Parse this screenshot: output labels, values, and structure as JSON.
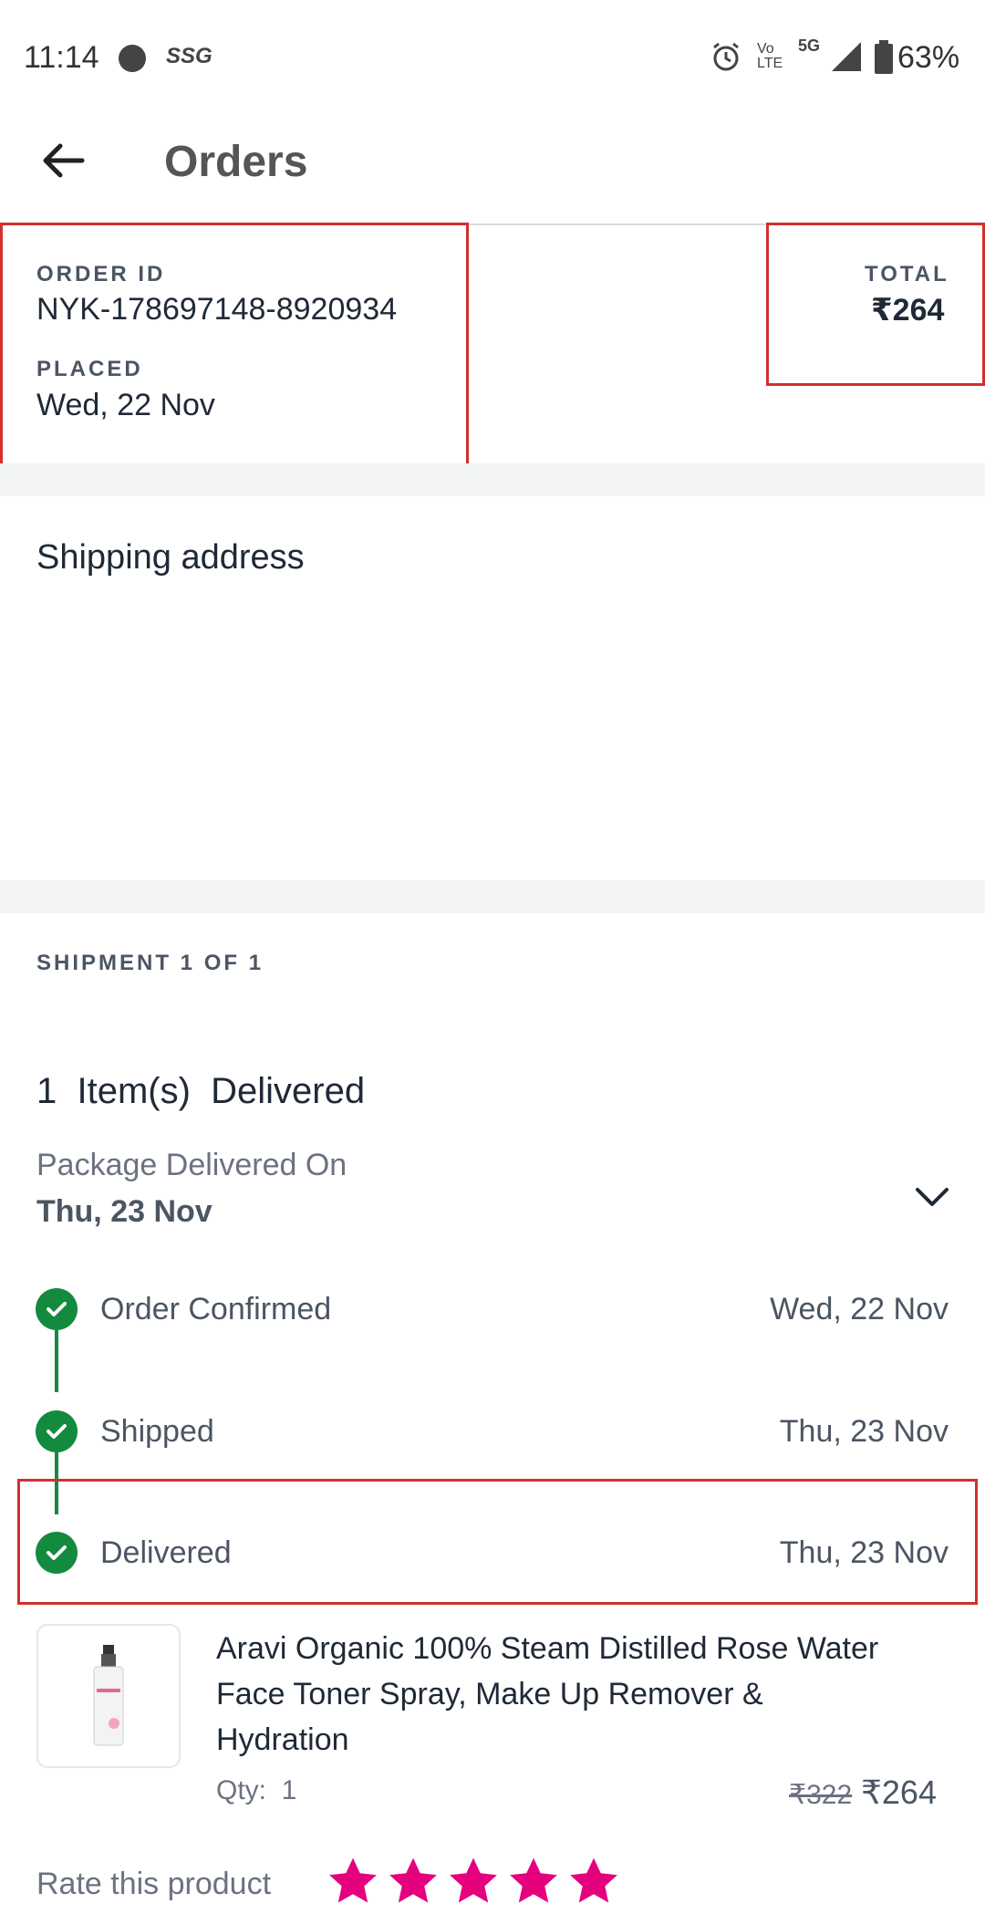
{
  "status_bar": {
    "time": "11:14",
    "carrier_tag": "SSG",
    "volte": "Vo LTE",
    "network": "5G",
    "battery": "63%"
  },
  "header": {
    "title": "Orders"
  },
  "order": {
    "order_id_label": "ORDER ID",
    "order_id": "NYK-178697148-8920934",
    "placed_label": "PLACED",
    "placed_date": "Wed, 22 Nov",
    "total_label": "TOTAL",
    "total_value": "₹264"
  },
  "shipping": {
    "title": "Shipping address"
  },
  "shipment": {
    "label": "SHIPMENT 1 OF 1",
    "status_title": "1  Item(s)  Delivered",
    "delivered_on_label": "Package Delivered On",
    "delivered_on_date": "Thu, 23 Nov",
    "timeline": [
      {
        "label": "Order Confirmed",
        "date": "Wed, 22 Nov"
      },
      {
        "label": "Shipped",
        "date": "Thu, 23 Nov"
      },
      {
        "label": "Delivered",
        "date": "Thu, 23 Nov"
      }
    ]
  },
  "product": {
    "name_line1": "Aravi Organic 100% Steam Distilled Rose Water",
    "name_line2": "Face Toner Spray, Make Up Remover &",
    "name_line3": "Hydration",
    "qty_label": "Qty:  1",
    "mrp": "₹322",
    "price": "₹264",
    "image_icon": "product-bottle-icon"
  },
  "rating": {
    "label": "Rate this product",
    "stars": 5,
    "star_color": "#e5007e"
  },
  "colors": {
    "accent_green": "#138a3e",
    "highlight_red": "#d32f2f",
    "brand_pink": "#e5007e"
  }
}
